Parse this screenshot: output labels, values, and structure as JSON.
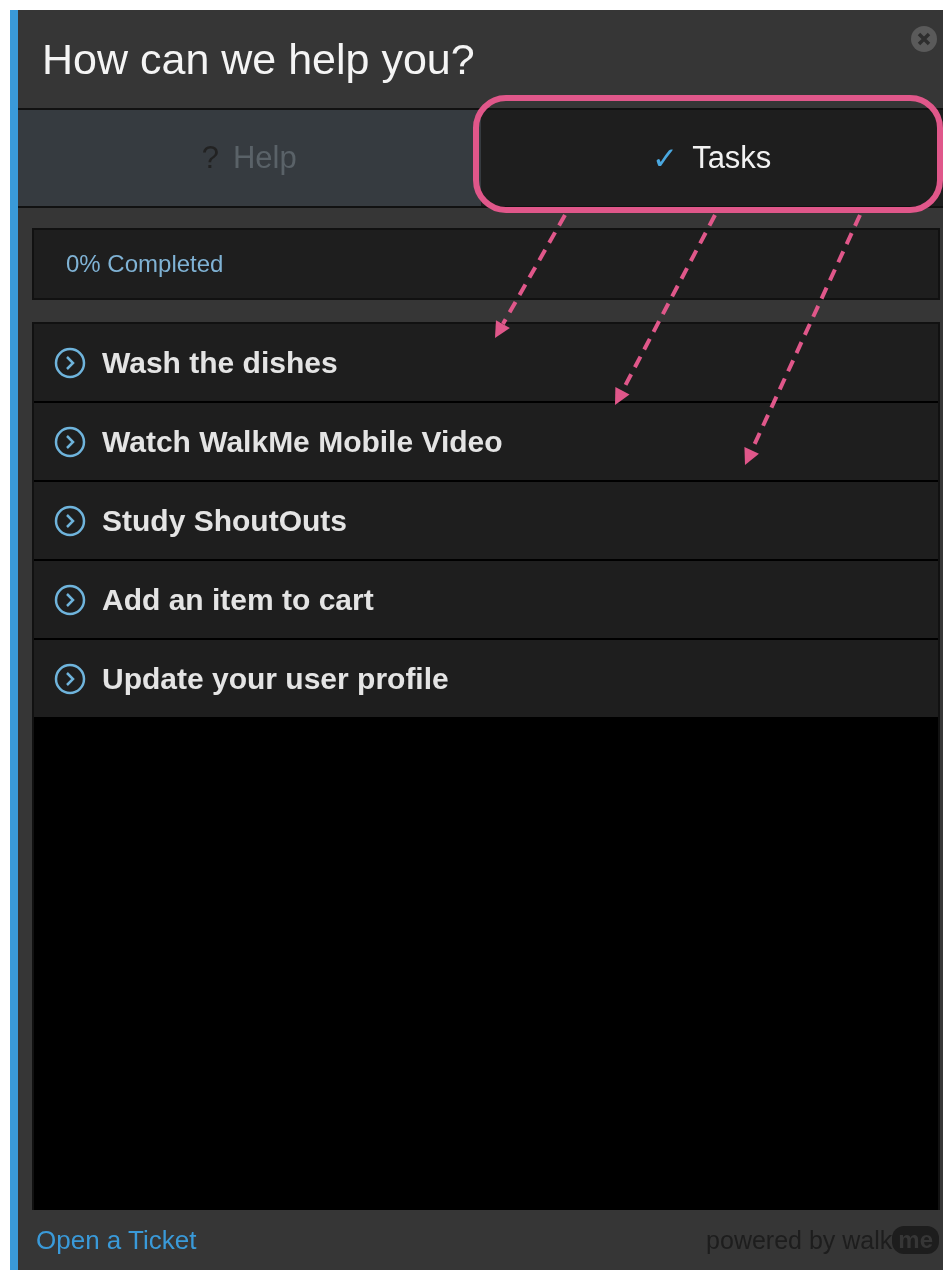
{
  "header": {
    "title": "How can we help you?"
  },
  "tabs": [
    {
      "icon": "?",
      "label": "Help",
      "selected": false
    },
    {
      "icon": "✓",
      "label": "Tasks",
      "selected": true
    }
  ],
  "progress": {
    "text": "0% Completed"
  },
  "tasks": [
    {
      "label": "Wash the dishes"
    },
    {
      "label": "Watch WalkMe Mobile Video"
    },
    {
      "label": "Study ShoutOuts"
    },
    {
      "label": "Add an item to cart"
    },
    {
      "label": "Update your user profile"
    }
  ],
  "footer": {
    "link": "Open a Ticket",
    "powered_by": "powered by walk",
    "logo_text": "me"
  }
}
